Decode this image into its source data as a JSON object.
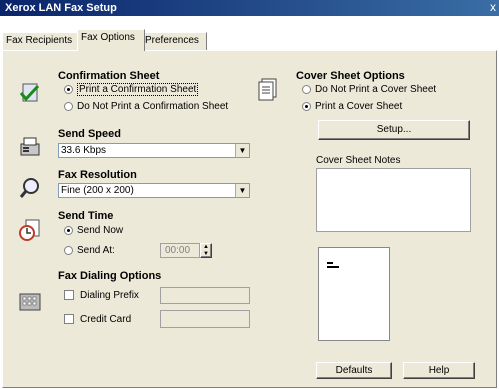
{
  "window": {
    "title": "Xerox LAN Fax Setup",
    "close_glyph": "x"
  },
  "tabs": [
    {
      "label": "Fax Recipients",
      "active": false
    },
    {
      "label": "Fax Options",
      "active": true
    },
    {
      "label": "Preferences",
      "active": false
    }
  ],
  "confirmation": {
    "heading": "Confirmation Sheet",
    "options": [
      {
        "label": "Print a Confirmation Sheet",
        "selected": true
      },
      {
        "label": "Do Not Print a Confirmation Sheet",
        "selected": false
      }
    ]
  },
  "send_speed": {
    "heading": "Send Speed",
    "value": "33.6 Kbps"
  },
  "fax_resolution": {
    "heading": "Fax Resolution",
    "value": "Fine (200 x 200)"
  },
  "send_time": {
    "heading": "Send Time",
    "options": [
      {
        "label": "Send Now",
        "selected": true
      },
      {
        "label": "Send At:",
        "selected": false
      }
    ],
    "time_value": "00:00"
  },
  "dialing": {
    "heading": "Fax Dialing Options",
    "dialing_prefix_label": "Dialing Prefix",
    "credit_card_label": "Credit Card"
  },
  "cover_sheet": {
    "heading": "Cover Sheet Options",
    "options": [
      {
        "label": "Do Not Print a Cover Sheet",
        "selected": false
      },
      {
        "label": "Print a Cover Sheet",
        "selected": true
      }
    ],
    "setup_label": "Setup...",
    "notes_label": "Cover Sheet Notes"
  },
  "buttons": {
    "defaults_label": "Defaults",
    "help_label": "Help"
  },
  "icons": {
    "confirmation": "checkmark-icon",
    "send_speed": "fax-machine-icon",
    "fax_resolution": "magnifier-icon",
    "send_time": "clock-icon",
    "dialing": "keypad-icon",
    "cover_sheet": "document-icon"
  }
}
